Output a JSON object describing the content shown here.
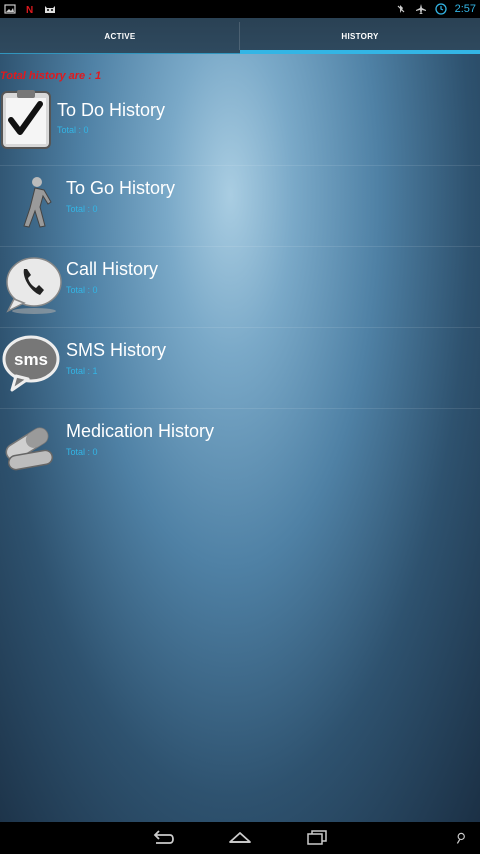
{
  "status": {
    "time": "2:57"
  },
  "tabs": [
    {
      "label": "ACTIVE"
    },
    {
      "label": "HISTORY"
    }
  ],
  "summary": "Total history are : 1",
  "items": [
    {
      "title": "To Do History",
      "total": "Total : 0",
      "icon": "clipboard-check-icon"
    },
    {
      "title": "To Go History",
      "total": "Total : 0",
      "icon": "walking-person-icon"
    },
    {
      "title": "Call History",
      "total": "Total : 0",
      "icon": "phone-bubble-icon"
    },
    {
      "title": "SMS History",
      "total": "Total : 1",
      "icon": "sms-bubble-icon"
    },
    {
      "title": "Medication History",
      "total": "Total : 0",
      "icon": "pills-icon"
    }
  ],
  "colors": {
    "accent": "#33b5e5",
    "summary": "#e0191e"
  }
}
